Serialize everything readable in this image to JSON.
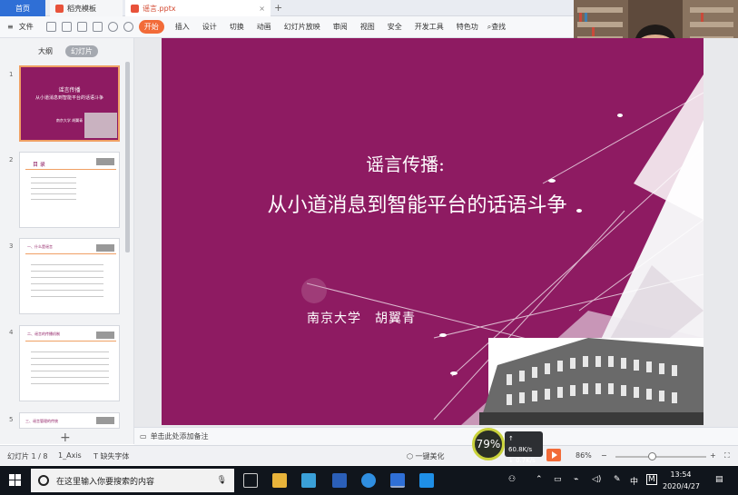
{
  "tabs": [
    {
      "label": "首页"
    },
    {
      "label": "稻壳模板"
    },
    {
      "label": "谣言.pptx"
    }
  ],
  "menu": {
    "file": "文件",
    "items": [
      "开始",
      "插入",
      "设计",
      "切换",
      "动画",
      "幻灯片放映",
      "审阅",
      "视图",
      "安全",
      "开发工具",
      "特色功"
    ],
    "active": "开始",
    "search": "查找"
  },
  "left_panel": {
    "tabs": [
      "大纲",
      "幻灯片"
    ],
    "active_tab": "幻灯片",
    "slides": [
      {
        "num": "1",
        "title": "谣言传播",
        "subtitle": "从小道消息到智能平台的话语斗争",
        "author": "南京大学 胡翼青"
      },
      {
        "num": "2",
        "title": "目 录"
      },
      {
        "num": "3",
        "title": "一、什么是谣言"
      },
      {
        "num": "4",
        "title": "二、谣言的传播机制"
      },
      {
        "num": "5",
        "title": "三、谣言管理的传统"
      }
    ]
  },
  "slide": {
    "title_line1": "谣言传播:",
    "title_line2": "从小道消息到智能平台的话语斗争",
    "author": "南京大学　胡翼青",
    "bg_color": "#8e1b62"
  },
  "notes_placeholder": "单击此处添加备注",
  "status": {
    "slide_indicator": "幻灯片 1 / 8",
    "theme": "1_Axis",
    "missing_font": "缺失字体",
    "beautify": "一键美化",
    "zoom": "86%",
    "cpu_gauge": "79%",
    "net_up": "60.8K/s",
    "net_down": "0.7K/s"
  },
  "taskbar": {
    "search_placeholder": "在这里输入你要搜索的内容",
    "ime": "中",
    "ime2": "M",
    "time": "13:54",
    "date": "2020/4/27"
  }
}
